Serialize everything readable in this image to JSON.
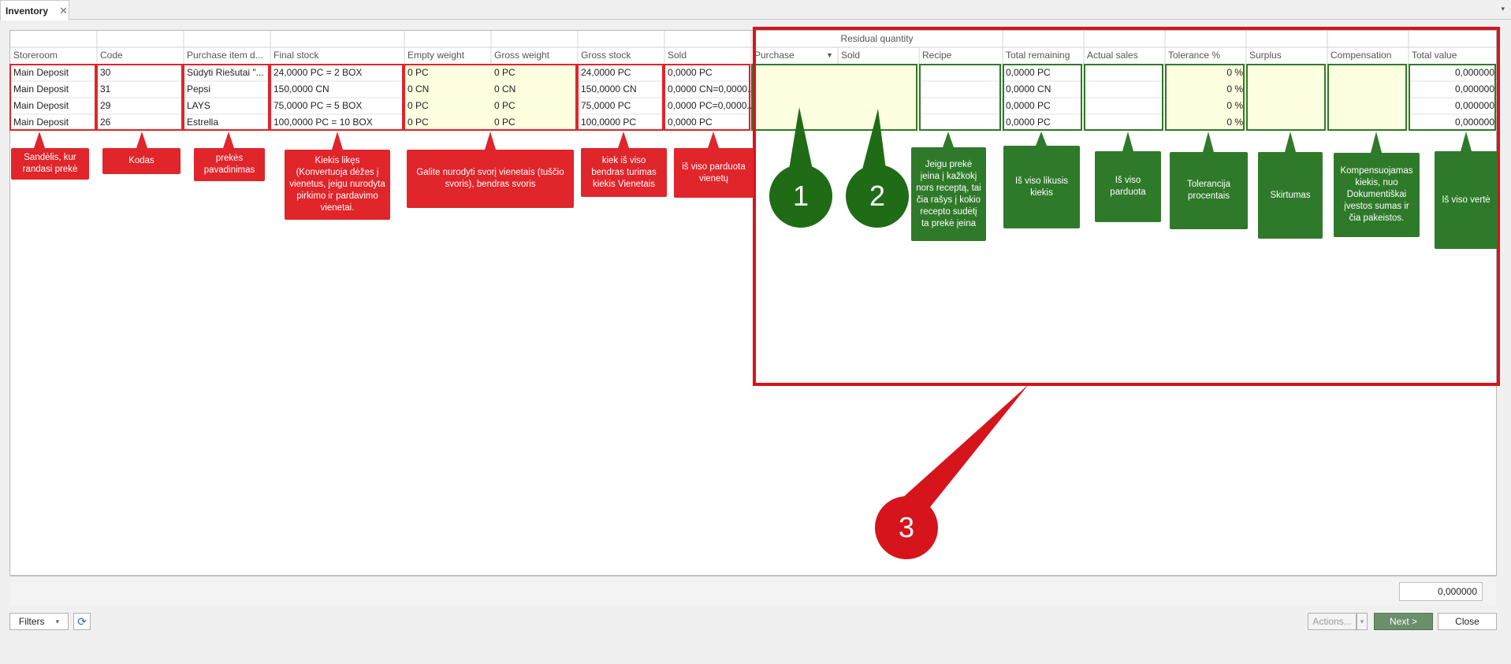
{
  "window": {
    "tab_title": "Inventory",
    "close_glyph": "✕",
    "menu_glyph": "▾"
  },
  "grid": {
    "group_header": "Residual quantity",
    "columns": [
      "Storeroom",
      "Code",
      "Purchase item d...",
      "Final stock",
      "Empty weight",
      "Gross weight",
      "Gross stock",
      "Sold",
      "Purchase",
      "Sold",
      "Recipe",
      "Total remaining",
      "Actual sales",
      "Tolerance %",
      "Surplus",
      "Compensation",
      "Total value"
    ],
    "purchase_dropdown_glyph": "▼",
    "rows": [
      [
        "Main Deposit",
        "30",
        "Sūdyti Riešutai \"...",
        "24,0000 PC = 2 BOX",
        "0 PC",
        "0 PC",
        "24,0000 PC",
        "0,0000 PC",
        "",
        "",
        "",
        "0,0000 PC",
        "",
        "0 %",
        "",
        "",
        "0,000000"
      ],
      [
        "Main Deposit",
        "31",
        "Pepsi",
        "150,0000 CN",
        "0 CN",
        "0 CN",
        "150,0000 CN",
        "0,0000 CN=0,0000...",
        "",
        "",
        "",
        "0,0000 CN",
        "",
        "0 %",
        "",
        "",
        "0,000000"
      ],
      [
        "Main Deposit",
        "29",
        "LAYS",
        "75,0000 PC = 5 BOX",
        "0 PC",
        "0 PC",
        "75,0000 PC",
        "0,0000 PC=0,0000...",
        "",
        "",
        "",
        "0,0000 PC",
        "",
        "0 %",
        "",
        "",
        "0,000000"
      ],
      [
        "Main Deposit",
        "26",
        "Estrella",
        "100,0000 PC = 10 BOX",
        "0 PC",
        "0 PC",
        "100,0000 PC",
        "0,0000 PC",
        "",
        "",
        "",
        "0,0000 PC",
        "",
        "0 %",
        "",
        "",
        "0,000000"
      ]
    ],
    "footer_total": "0,000000"
  },
  "toolbar": {
    "filters_label": "Filters",
    "filters_glyph": "▾",
    "refresh_glyph": "⟳",
    "actions_label": "Actions...",
    "actions_glyph": "▾",
    "next_label": "Next >",
    "close_label": "Close"
  },
  "annotations": {
    "red": [
      "Sandėlis, kur randasi prekė",
      "Kodas",
      "prekės pavadinimas",
      "Kiekis likęs (Konvertuoja dėžes į vienetus, jeigu nurodyta pirkimo ir pardavimo vienetai.",
      "Galite nurodyti svorį vienetais (tuščio svoris),  bendras svoris",
      "kiek iš viso bendras turimas kiekis Vienetais",
      "iš viso parduota vienetų"
    ],
    "green": [
      "Jeigu prekė įeina į kažkokį nors receptą, tai čia rašys į kokio recepto sudėtį ta prekė įeina",
      "Iš viso likusis kiekis",
      "Iš viso parduota",
      "Tolerancija procentais",
      "Skirtumas",
      "Kompensuojamas kiekis, nuo Dokumentiškai įvestos sumas ir čia pakeistos.",
      "Iš viso vertė"
    ],
    "circles": [
      "1",
      "2",
      "3"
    ]
  },
  "colors": {
    "annotation_red": "#e0252b",
    "annotation_green": "#2f7a2a",
    "yellow_cell": "#fefee0",
    "next_button": "#6b8e6b"
  }
}
